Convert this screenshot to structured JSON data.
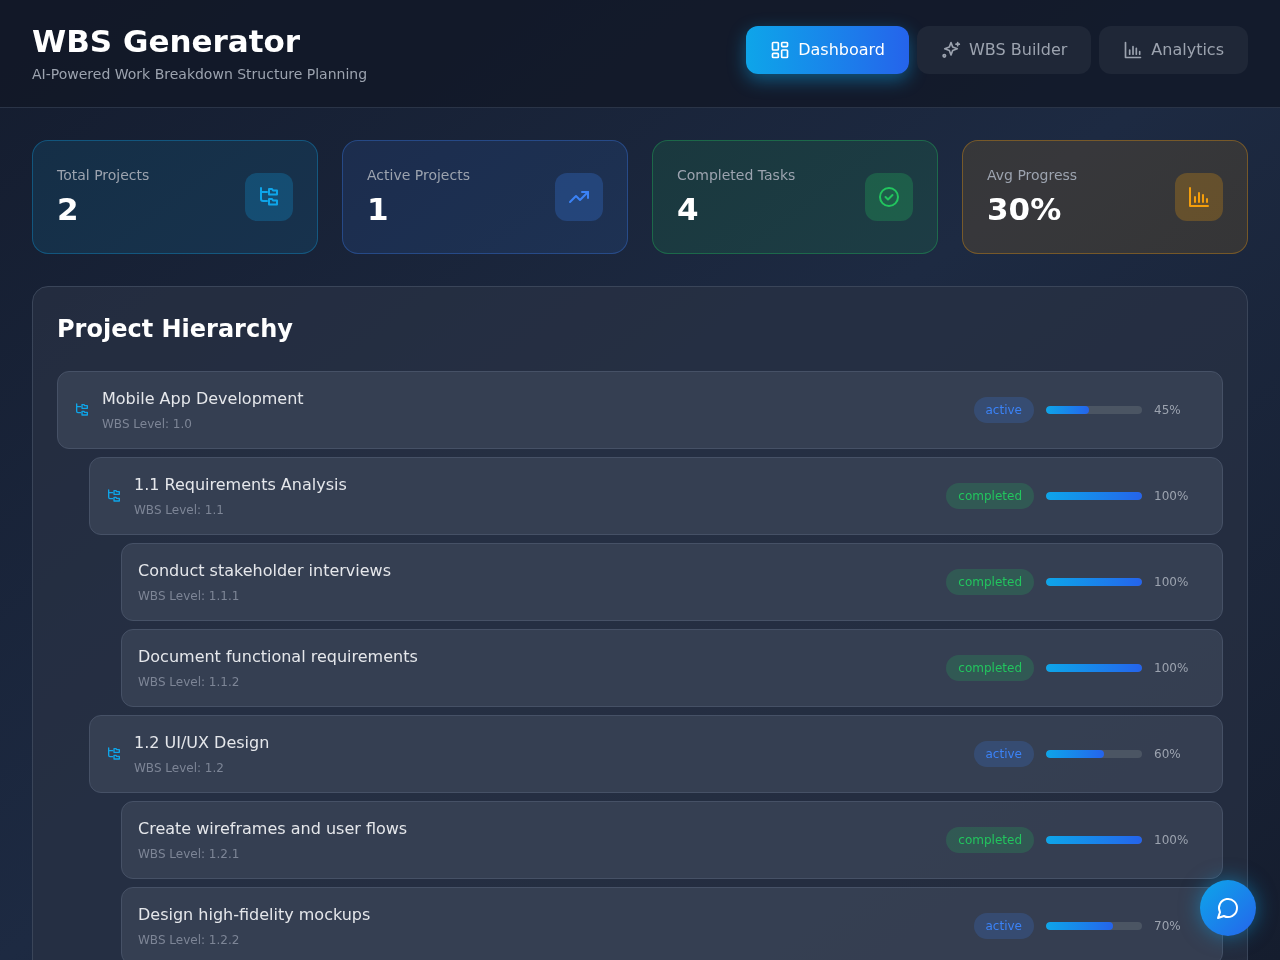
{
  "header": {
    "title": "WBS Generator",
    "subtitle": "AI-Powered Work Breakdown Structure Planning"
  },
  "tabs": [
    {
      "label": "Dashboard",
      "selected": true,
      "kind": "grid"
    },
    {
      "label": "WBS Builder",
      "selected": false,
      "kind": "sparkle"
    },
    {
      "label": "Analytics",
      "selected": false,
      "kind": "chart"
    }
  ],
  "stats": [
    {
      "label": "Total Projects",
      "value": "2",
      "kind": "tree",
      "color": "#0ea5e9"
    },
    {
      "label": "Active Projects",
      "value": "1",
      "kind": "trend",
      "color": "#3b82f6"
    },
    {
      "label": "Completed Tasks",
      "value": "4",
      "kind": "check",
      "color": "#22c55e"
    },
    {
      "label": "Avg Progress",
      "value": "30%",
      "kind": "bars",
      "color": "#f59e0b"
    }
  ],
  "hierarchy": {
    "title": "Project Hierarchy",
    "items": [
      {
        "name": "Mobile App Development",
        "level_text": "WBS Level: 1.0",
        "status": "active",
        "kind": "active",
        "level": 0.45,
        "percent": "45%",
        "children": [
          {
            "name": "1.1 Requirements Analysis",
            "level_text": "WBS Level: 1.1",
            "status": "completed",
            "kind": "done",
            "level": 1,
            "percent": "100%",
            "children": [
              {
                "name": "Conduct stakeholder interviews",
                "level_text": "WBS Level: 1.1.1",
                "status": "completed",
                "kind": "done",
                "level": 1,
                "percent": "100%"
              },
              {
                "name": "Document functional requirements",
                "level_text": "WBS Level: 1.1.2",
                "status": "completed",
                "kind": "done",
                "level": 1,
                "percent": "100%"
              }
            ]
          },
          {
            "name": "1.2 UI/UX Design",
            "level_text": "WBS Level: 1.2",
            "status": "active",
            "kind": "active",
            "level": 0.6,
            "percent": "60%",
            "children": [
              {
                "name": "Create wireframes and user flows",
                "level_text": "WBS Level: 1.2.1",
                "status": "completed",
                "kind": "done",
                "level": 1,
                "percent": "100%"
              },
              {
                "name": "Design high-fidelity mockups",
                "level_text": "WBS Level: 1.2.2",
                "status": "active",
                "kind": "active",
                "level": 0.7,
                "percent": "70%"
              }
            ]
          }
        ]
      }
    ]
  }
}
